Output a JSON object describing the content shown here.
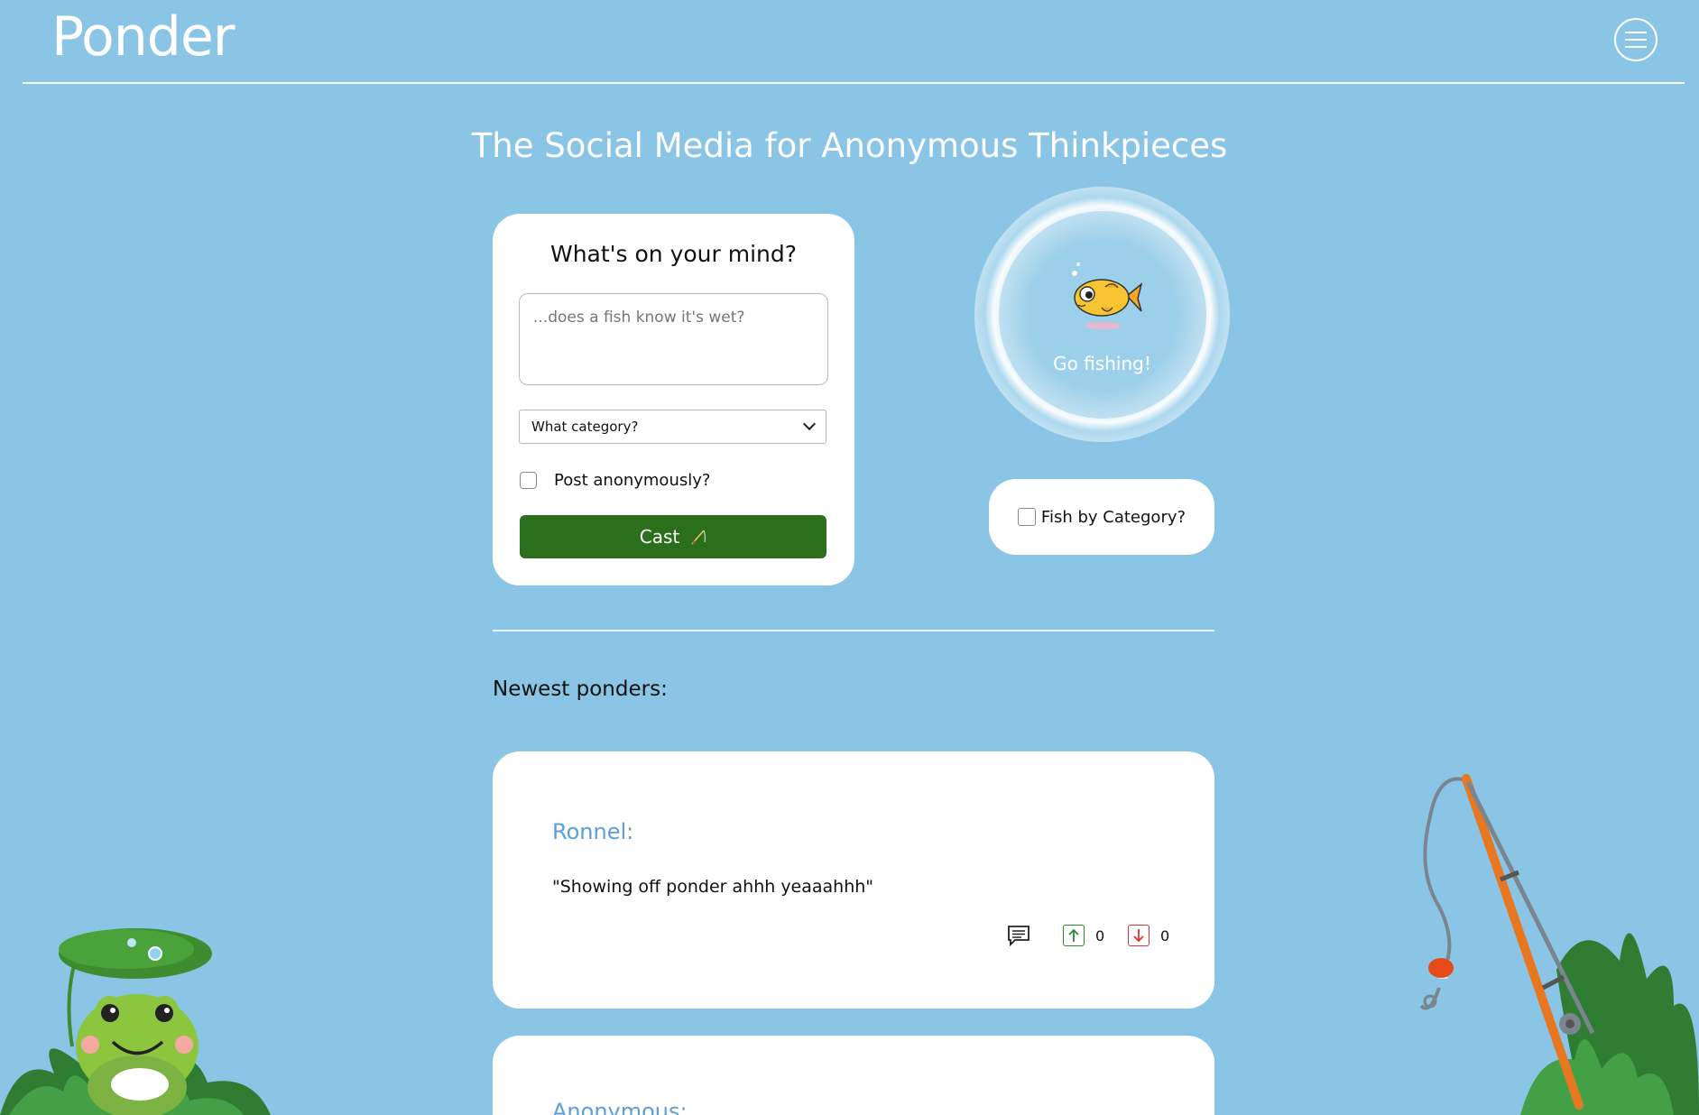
{
  "header": {
    "logo": "Ponder"
  },
  "tagline": "The Social Media for Anonymous Thinkpieces",
  "post_form": {
    "title": "What's on your mind?",
    "textarea_placeholder": "...does a fish know it's wet?",
    "category_select": "What category?",
    "anon_label": "Post anonymously?",
    "cast_label": "Cast"
  },
  "fishing": {
    "label": "Go fishing!",
    "category_label": "Fish by Category?"
  },
  "feed": {
    "heading": "Newest ponders:",
    "posts": [
      {
        "author": "Ronnel:",
        "text": "\"Showing off ponder ahhh yeaaahhh\"",
        "upvotes": "0",
        "downvotes": "0"
      },
      {
        "author": "Anonymous:",
        "text": ""
      }
    ]
  },
  "colors": {
    "background": "#8bc5e5",
    "cast_button": "#2b6e1b",
    "author": "#5c9fd8"
  }
}
